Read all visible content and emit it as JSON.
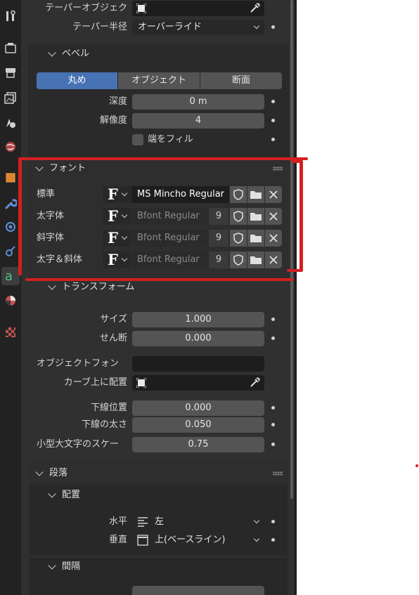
{
  "sidebar": {
    "tabs": [
      {
        "icon": "tool-icon"
      },
      {
        "icon": "render-icon"
      },
      {
        "icon": "output-icon"
      },
      {
        "icon": "view-layer-icon"
      },
      {
        "icon": "scene-icon"
      },
      {
        "icon": "world-icon"
      },
      {
        "icon": "object-icon"
      },
      {
        "icon": "modifier-wrench-icon"
      },
      {
        "icon": "physics-icon"
      },
      {
        "icon": "constraints-icon"
      },
      {
        "icon": "text-data-icon"
      },
      {
        "icon": "material-icon"
      },
      {
        "icon": "texture-icon"
      }
    ]
  },
  "geometry": {
    "taper_object_label": "テーパーオブジェク",
    "taper_radius_label": "テーパー半径",
    "taper_radius_value": "オーバーライド"
  },
  "bevel": {
    "header": "ベベル",
    "modes": [
      "丸め",
      "オブジェクト",
      "断面"
    ],
    "active_mode": "丸め",
    "depth_label": "深度",
    "depth_value": "0 m",
    "resolution_label": "解像度",
    "resolution_value": "4",
    "fill_caps_label": "端をフィル"
  },
  "font": {
    "header": "フォント",
    "rows": [
      {
        "label": "標準",
        "name": "MS Mincho Regular",
        "users": ""
      },
      {
        "label": "太字体",
        "name": "Bfont Regular",
        "users": "9"
      },
      {
        "label": "斜字体",
        "name": "Bfont Regular",
        "users": "9"
      },
      {
        "label": "太字＆斜体",
        "name": "Bfont Regular",
        "users": "9"
      }
    ]
  },
  "transform": {
    "header": "トランスフォーム",
    "size_label": "サイズ",
    "size_value": "1.000",
    "shear_label": "せん断",
    "shear_value": "0.000",
    "object_font_label": "オブジェクトフォン",
    "object_font_value": "",
    "follow_curve_label": "カーブ上に配置",
    "underline_pos_label": "下線位置",
    "underline_pos_value": "0.000",
    "underline_thick_label": "下線の太さ",
    "underline_thick_value": "0.050",
    "smallcaps_label": "小型大文字のスケー",
    "smallcaps_value": "0.75"
  },
  "paragraph": {
    "header": "段落",
    "alignment_header": "配置",
    "horizontal_label": "水平",
    "horizontal_value": "左",
    "vertical_label": "垂直",
    "vertical_value": "上(ベースライン)",
    "spacing_header": "間隔"
  },
  "colors": {
    "accent": "#4772b3",
    "highlight": "#d41f1f",
    "panel_bg": "#303030"
  }
}
